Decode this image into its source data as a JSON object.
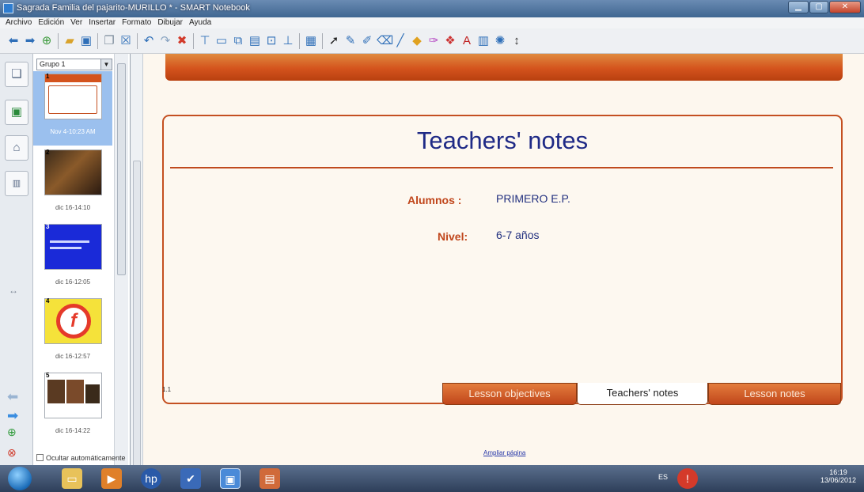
{
  "window": {
    "title": "Sagrada Familia del pajarito-MURILLO * - SMART Notebook"
  },
  "menu": [
    "Archivo",
    "Edición",
    "Ver",
    "Insertar",
    "Formato",
    "Dibujar",
    "Ayuda"
  ],
  "toolbar_icons": [
    "back-icon",
    "forward-icon",
    "add-page-icon",
    "open-icon",
    "save-icon",
    "paste-icon",
    "delete-page-icon",
    "undo-icon",
    "redo-icon",
    "delete-icon",
    "screen-shade-icon",
    "display-icon",
    "dual-display-icon",
    "screen-capture-icon",
    "document-camera-icon",
    "pen-mode-icon",
    "table-icon",
    "select-icon",
    "pen-icon",
    "creative-pen-icon",
    "eraser-icon",
    "line-icon",
    "shape-icon",
    "magic-pen-icon",
    "fill-icon",
    "text-icon",
    "properties-icon",
    "recognition-icon",
    "more-icon"
  ],
  "sorter": {
    "group": "Grupo 1",
    "pages": [
      {
        "num": "1",
        "caption": "Nov 4-10:23 AM",
        "selected": true
      },
      {
        "num": "2",
        "caption": "dic 16-14:10",
        "selected": false
      },
      {
        "num": "3",
        "caption": "dic 16-12:05",
        "selected": false
      },
      {
        "num": "4",
        "caption": "dic 16-12:57",
        "selected": false
      },
      {
        "num": "5",
        "caption": "dic 16-14:22",
        "selected": false
      }
    ],
    "autohide_label": "Ocultar automáticamente"
  },
  "slide": {
    "title": "Teachers' notes",
    "fields": [
      {
        "label": "Alumnos :",
        "value": "PRIMERO E.P."
      },
      {
        "label": "Nivel:",
        "value": "6-7 años"
      }
    ],
    "page_number": "1.1",
    "tabs": [
      {
        "label": "Lesson objectives",
        "style": "orange"
      },
      {
        "label": "Teachers' notes",
        "style": "white"
      },
      {
        "label": "Lesson notes",
        "style": "orange"
      }
    ],
    "expand_link": "Ampliar página"
  },
  "taskbar": {
    "language": "ES",
    "time": "16:19",
    "date": "13/06/2012"
  },
  "colors": {
    "accent_orange": "#d4531d",
    "title_blue": "#1f2a86",
    "label_orange": "#c0461b"
  }
}
